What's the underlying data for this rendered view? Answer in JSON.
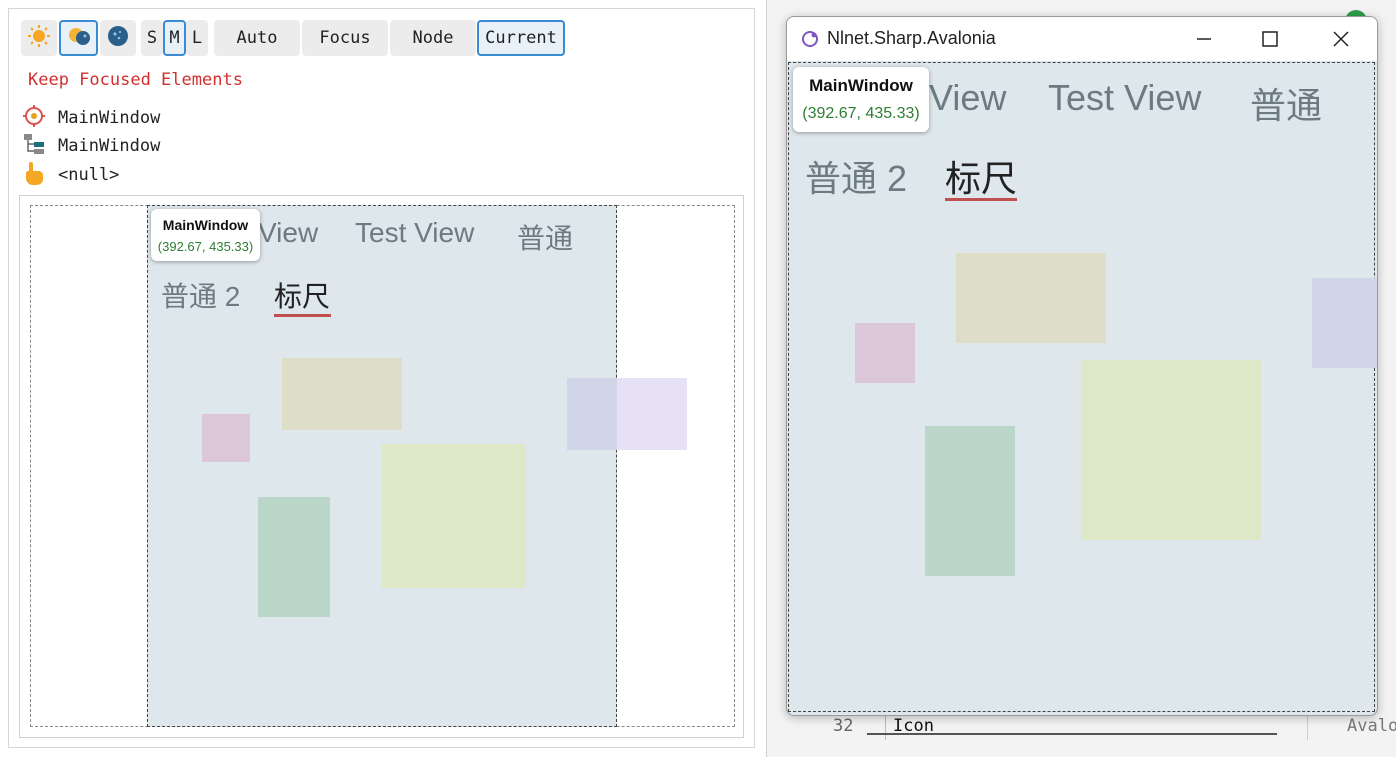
{
  "toolbar": {
    "theme_buttons": [
      {
        "icon": "sun-icon"
      },
      {
        "icon": "sun-moon-icon"
      },
      {
        "icon": "moon-icon"
      }
    ],
    "size_buttons": [
      "S",
      "M",
      "L"
    ],
    "size_selected": "M",
    "mode_buttons": [
      "Auto",
      "Focus",
      "Node",
      "Current"
    ],
    "mode_selected": "Current"
  },
  "keep_focused_label": "Keep Focused Elements",
  "tree": [
    {
      "icon": "target-icon",
      "label": "MainWindow"
    },
    {
      "icon": "tree-icon",
      "label": "MainWindow"
    },
    {
      "icon": "pointer-hand-icon",
      "label": "<null>"
    }
  ],
  "preview": {
    "tabs_row1": [
      "View",
      "Test View",
      "普通"
    ],
    "tabs_row2": [
      "普通 2",
      "标尺"
    ],
    "selected_tab": "标尺",
    "tooltip_title": "MainWindow",
    "tooltip_coords": "(392.67, 435.33)"
  },
  "app_window": {
    "title": "Nlnet.Sharp.Avalonia",
    "controls": [
      "minimize-icon",
      "maximize-icon",
      "close-icon"
    ],
    "tabs_row1": [
      "View",
      "Test View",
      "普通"
    ],
    "tabs_row2": [
      "普通 2",
      "标尺"
    ],
    "selected_tab": "标尺",
    "tooltip_title": "MainWindow",
    "tooltip_coords": "(392.67, 435.33)"
  },
  "editor": {
    "line_number": "32",
    "line_text": "Icon",
    "right_text": "Avalo"
  },
  "colors": {
    "accent": "#3a8ad6",
    "keep_focused": "#d32f2f",
    "tab_underline": "#c0504d",
    "content_bg": "#dde7ec"
  }
}
